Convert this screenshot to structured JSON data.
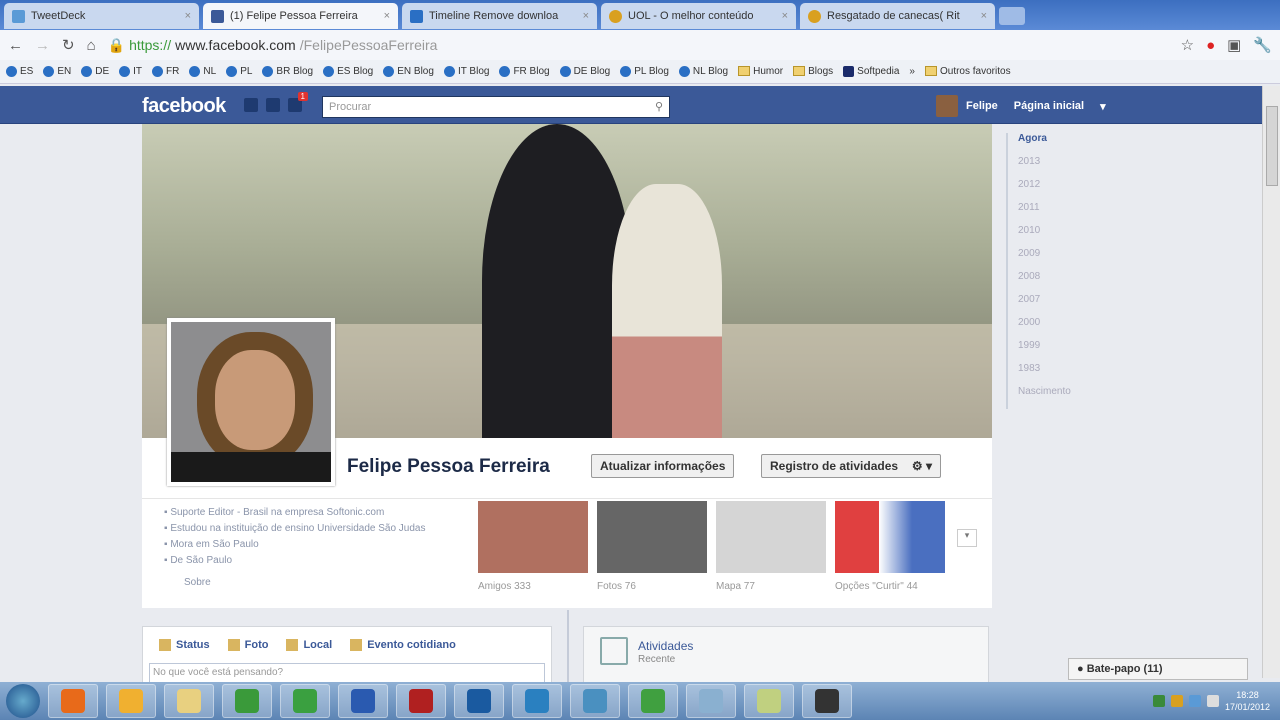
{
  "browser": {
    "tabs": [
      {
        "label": "TweetDeck",
        "color": "#5a9ad6"
      },
      {
        "label": "(1) Felipe Pessoa Ferreira",
        "color": "#3b5998"
      },
      {
        "label": "Timeline Remove downloa",
        "color": "#2a6fc4"
      },
      {
        "label": "UOL - O melhor conteúdo",
        "color": "#d9a020"
      },
      {
        "label": "Resgatado de canecas( Rit",
        "color": "#d9a020"
      }
    ],
    "url_scheme": "https://",
    "url_host": "www.facebook.com",
    "url_path": "/FelipePessoaFerreira",
    "bookmarks": [
      "ES",
      "EN",
      "DE",
      "IT",
      "FR",
      "NL",
      "PL",
      "BR Blog",
      "ES Blog",
      "EN Blog",
      "IT Blog",
      "FR Blog",
      "DE Blog",
      "PL Blog",
      "NL Blog"
    ],
    "folders": [
      "Humor",
      "Blogs"
    ],
    "softpedia": "Softpedia",
    "other": "Outros favoritos"
  },
  "fb": {
    "logo": "facebook",
    "notif_count": "1",
    "search_placeholder": "Procurar",
    "user": "Felipe",
    "home": "Página inicial",
    "profile_name": "Felipe Pessoa Ferreira",
    "update_info": "Atualizar informações",
    "activity_log": "Registro de atividades",
    "about": [
      "Suporte Editor - Brasil na empresa Softonic.com",
      "Estudou na instituição de ensino Universidade São Judas",
      "Mora em São Paulo",
      "De São Paulo"
    ],
    "about_more": "Sobre",
    "thumbs": [
      {
        "label": "Amigos 333",
        "color": "#b07060"
      },
      {
        "label": "Fotos 76",
        "color": "#666"
      },
      {
        "label": "Mapa 77",
        "color": "#d5d5d5"
      },
      {
        "label": "Opções \"Curtir\" 44",
        "color": "#4a6fc0"
      }
    ],
    "composer_tabs": [
      "Status",
      "Foto",
      "Local",
      "Evento cotidiano"
    ],
    "composer_placeholder": "No que você está pensando?",
    "activity_title": "Atividades",
    "activity_sub": "Recente",
    "timeline": [
      "Agora",
      "2013",
      "2012",
      "2011",
      "2010",
      "2009",
      "2008",
      "2007",
      "2000",
      "1999",
      "1983",
      "Nascimento"
    ],
    "chat": "Bate-papo (11)"
  },
  "taskbar": {
    "apps": [
      "#e86a1a",
      "#f0b030",
      "#e8d080",
      "#3a9a3a",
      "#3aa040",
      "#2a5ab0",
      "#b02020",
      "#1a5aa0",
      "#2a80c0",
      "#4a90c0",
      "#40a040",
      "#8ab0d0",
      "#c0d080",
      "#333"
    ],
    "time": "18:28",
    "date": "17/01/2012"
  }
}
